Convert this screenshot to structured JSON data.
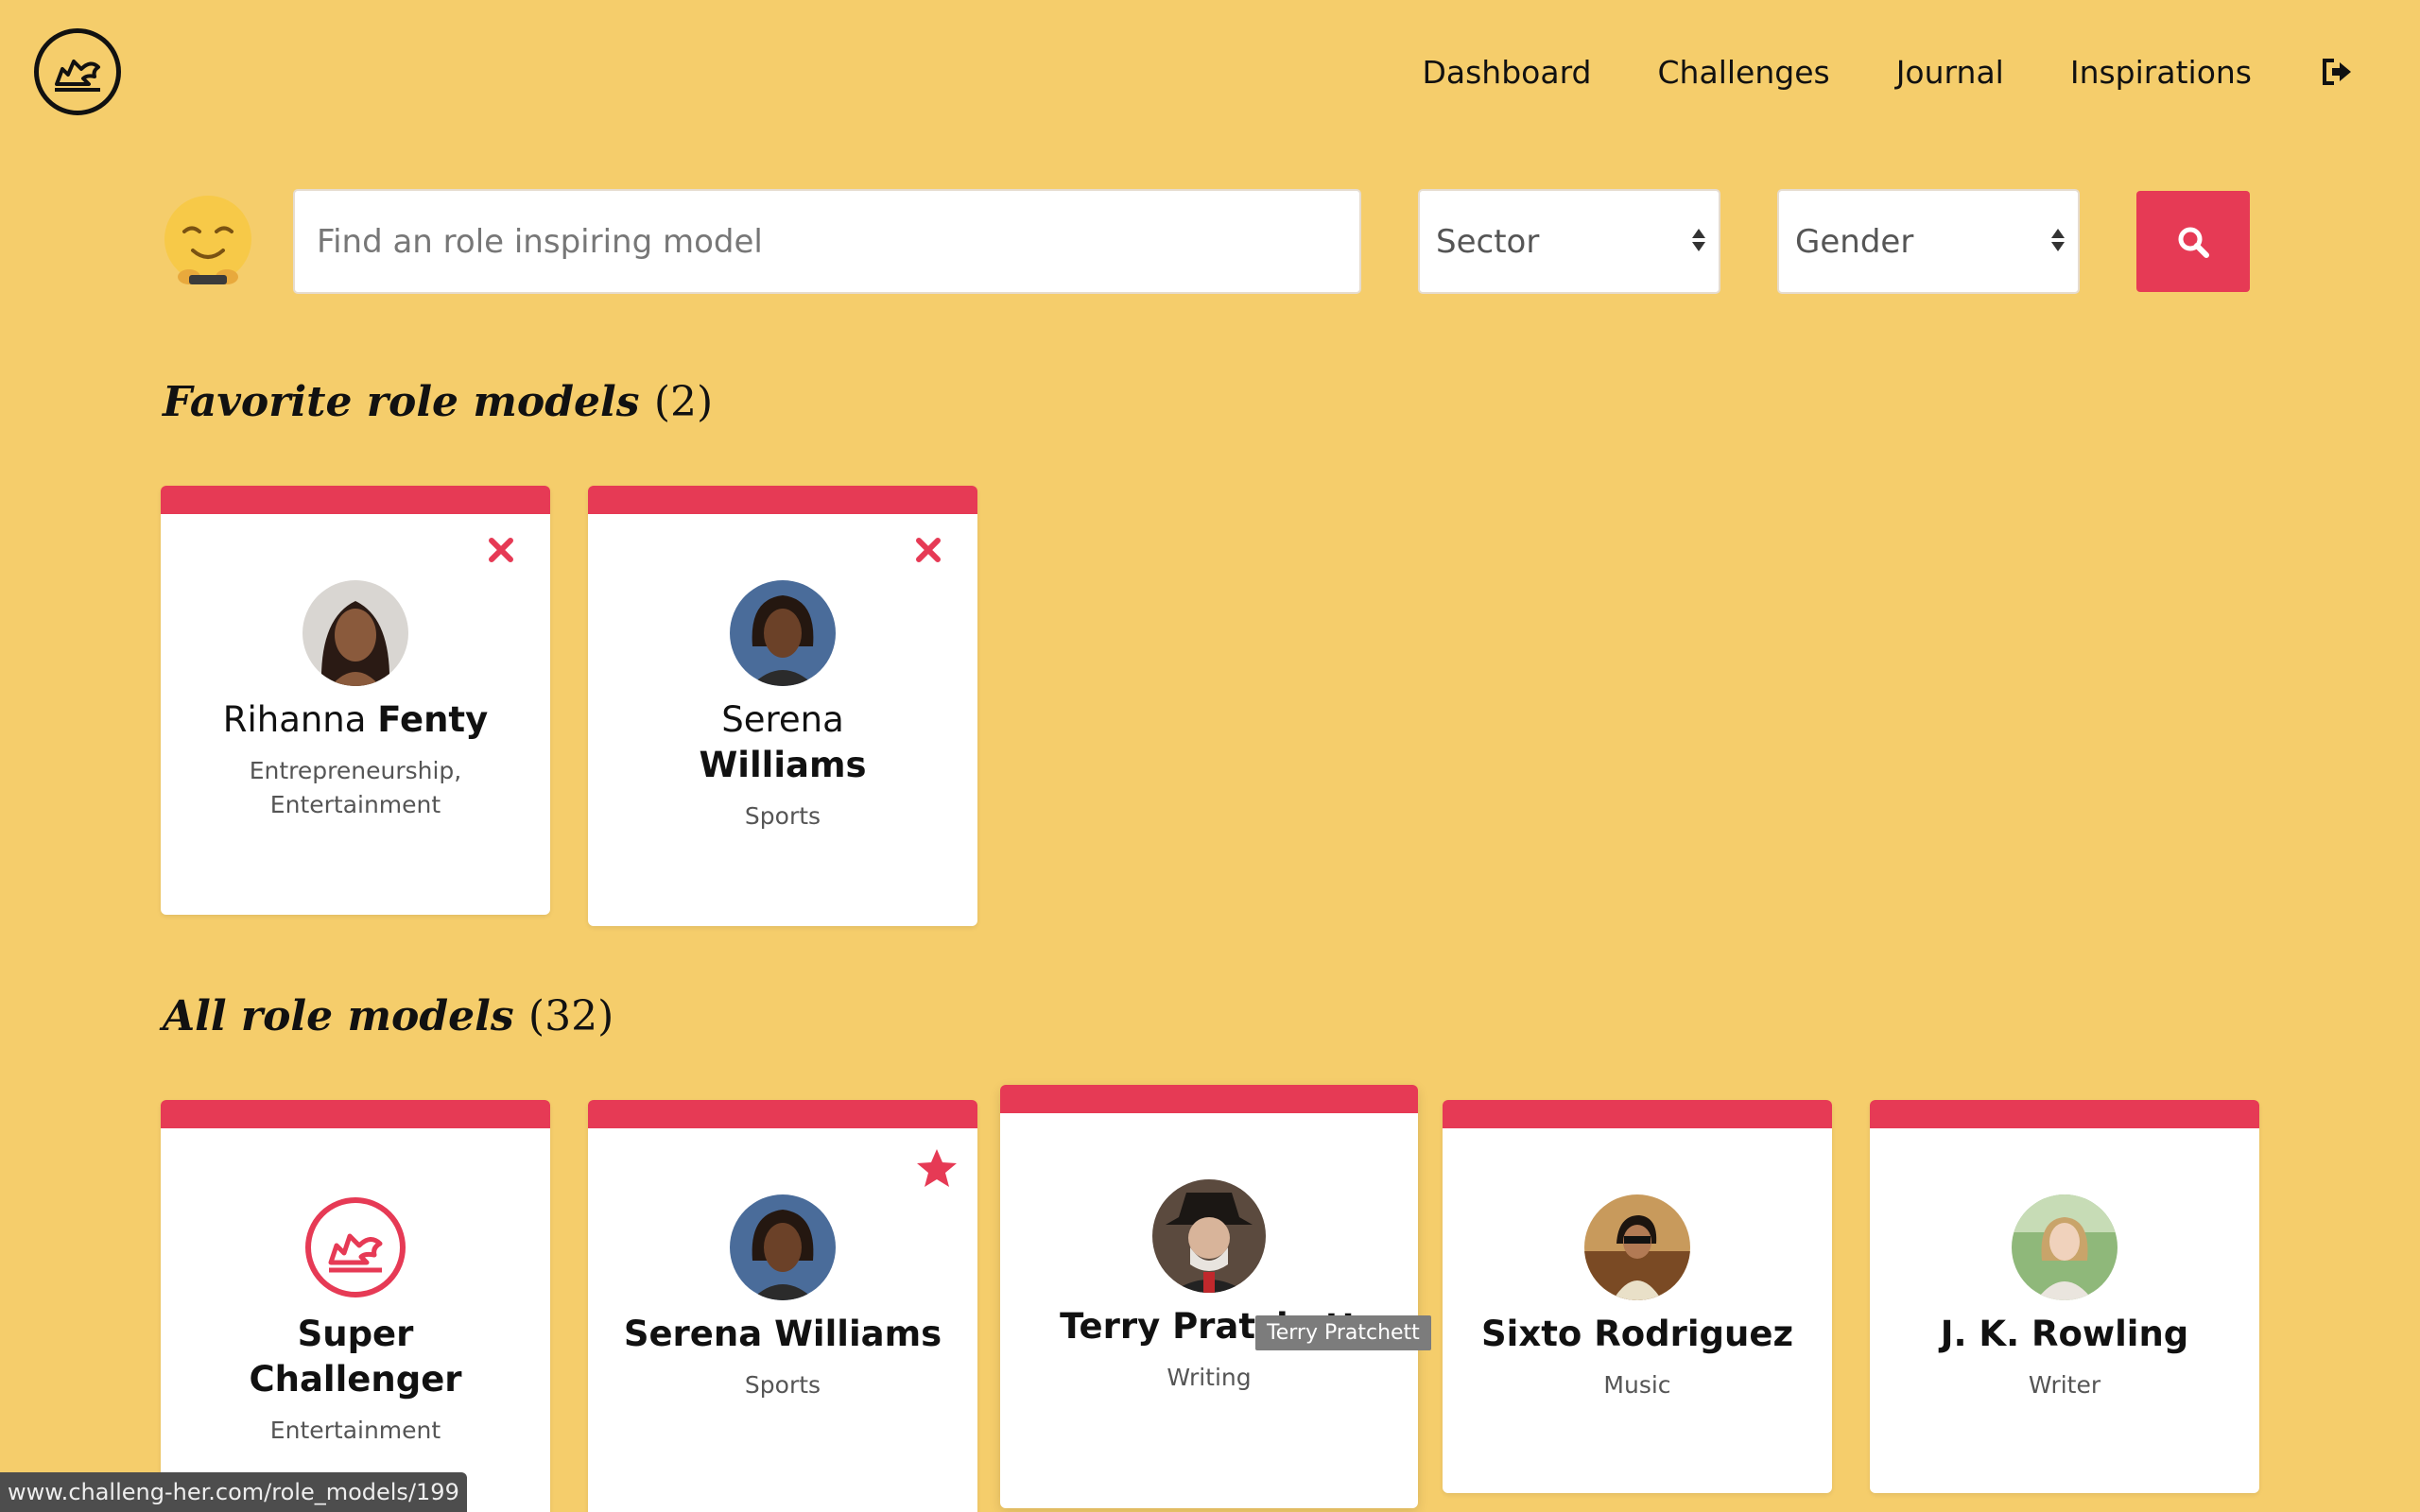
{
  "nav": {
    "items": [
      "Dashboard",
      "Challenges",
      "Journal",
      "Inspirations"
    ],
    "logout_icon": "logout-icon"
  },
  "search": {
    "placeholder": "Find an role inspiring model",
    "sector_label": "Sector",
    "gender_label": "Gender",
    "button_icon": "search-icon"
  },
  "favorites": {
    "title": "Favorite role models",
    "count": "(2)",
    "cards": [
      {
        "first": "Rihanna",
        "last": "Fenty",
        "sector": "Entrepreneurship, Entertainment"
      },
      {
        "first": "Serena",
        "last": "Williams",
        "sector": "Sports"
      }
    ]
  },
  "all": {
    "title": "All role models",
    "count": "(32)",
    "cards": [
      {
        "name": "Super Challenger",
        "sector": "Entertainment"
      },
      {
        "name": "Serena Williams",
        "sector": "Sports"
      },
      {
        "name": "Terry Pratchett",
        "sector": "Writing"
      },
      {
        "name": "Sixto Rodriguez",
        "sector": "Music"
      },
      {
        "name": "J. K. Rowling",
        "sector": "Writer"
      }
    ]
  },
  "tooltip": "Terry Pratchett",
  "status_url": "www.challeng-her.com/role_models/199",
  "colors": {
    "background": "#f5cd6b",
    "accent": "#e63a55"
  }
}
